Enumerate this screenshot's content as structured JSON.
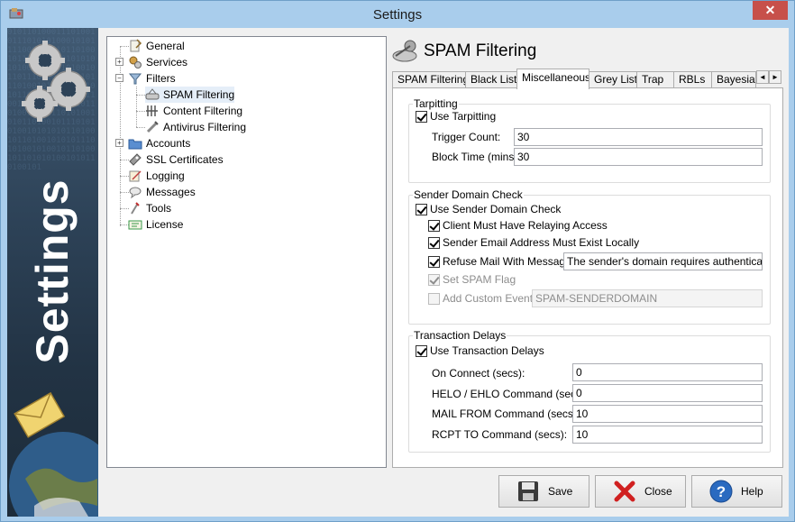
{
  "window": {
    "title": "Settings",
    "close_glyph": "✕"
  },
  "banner": {
    "text": "Settings",
    "binary": "0101101000111010010111010101000101011110001010101101001011010011101010101010001110010100101101110100010101011101001010110100101011010100101001110010101011010010110100101011101010010101101001011101010100101010101101001011010010101011101010010100101101001011010101001010110100101"
  },
  "tree": {
    "items": [
      {
        "label": "General",
        "icon": "general-icon"
      },
      {
        "label": "Services",
        "icon": "services-icon"
      },
      {
        "label": "Filters",
        "icon": "filters-icon"
      },
      {
        "label": "SPAM Filtering",
        "icon": "spam-filter-icon"
      },
      {
        "label": "Content Filtering",
        "icon": "content-filter-icon"
      },
      {
        "label": "Antivirus Filtering",
        "icon": "antivirus-icon"
      },
      {
        "label": "Accounts",
        "icon": "folder-icon"
      },
      {
        "label": "SSL Certificates",
        "icon": "certificate-icon"
      },
      {
        "label": "Logging",
        "icon": "logging-icon"
      },
      {
        "label": "Messages",
        "icon": "messages-icon"
      },
      {
        "label": "Tools",
        "icon": "tools-icon"
      },
      {
        "label": "License",
        "icon": "license-icon"
      }
    ],
    "expander_collapsed": "+",
    "expander_expanded": "−"
  },
  "panel": {
    "title": "SPAM Filtering",
    "tabs": [
      "SPAM Filtering",
      "Black List",
      "Miscellaneous",
      "Grey List",
      "Trap",
      "RBLs",
      "Bayesia"
    ],
    "active_tab": "Miscellaneous",
    "tab_scroll_left": "◄",
    "tab_scroll_right": "►"
  },
  "tarpitting": {
    "group_title": "Tarpitting",
    "use_label": "Use Tarpitting",
    "use_checked": true,
    "trigger_label": "Trigger Count:",
    "trigger_value": "30",
    "block_label": "Block Time (mins):",
    "block_value": "30"
  },
  "sender_domain": {
    "group_title": "Sender Domain Check",
    "use_label": "Use Sender Domain Check",
    "relay_label": "Client Must Have Relaying Access",
    "exist_label": "Sender Email Address Must Exist Locally",
    "refuse_label": "Refuse Mail With Message:",
    "refuse_value": "The sender's domain requires authentication c",
    "spam_flag_label": "Set SPAM Flag",
    "custom_event_label": "Add Custom Event:",
    "custom_event_value": "SPAM-SENDERDOMAIN"
  },
  "transaction": {
    "group_title": "Transaction Delays",
    "use_label": "Use Transaction Delays",
    "rows": [
      {
        "label": "On Connect (secs):",
        "value": "0"
      },
      {
        "label": "HELO / EHLO Command (secs):",
        "value": "0"
      },
      {
        "label": "MAIL FROM Command (secs):",
        "value": "10"
      },
      {
        "label": "RCPT TO Command (secs):",
        "value": "10"
      }
    ]
  },
  "buttons": {
    "save": "Save",
    "close": "Close",
    "help": "Help"
  },
  "colors": {
    "window_frame": "#a9cdec",
    "close_button": "#c7504a",
    "banner": "#2d4257"
  }
}
